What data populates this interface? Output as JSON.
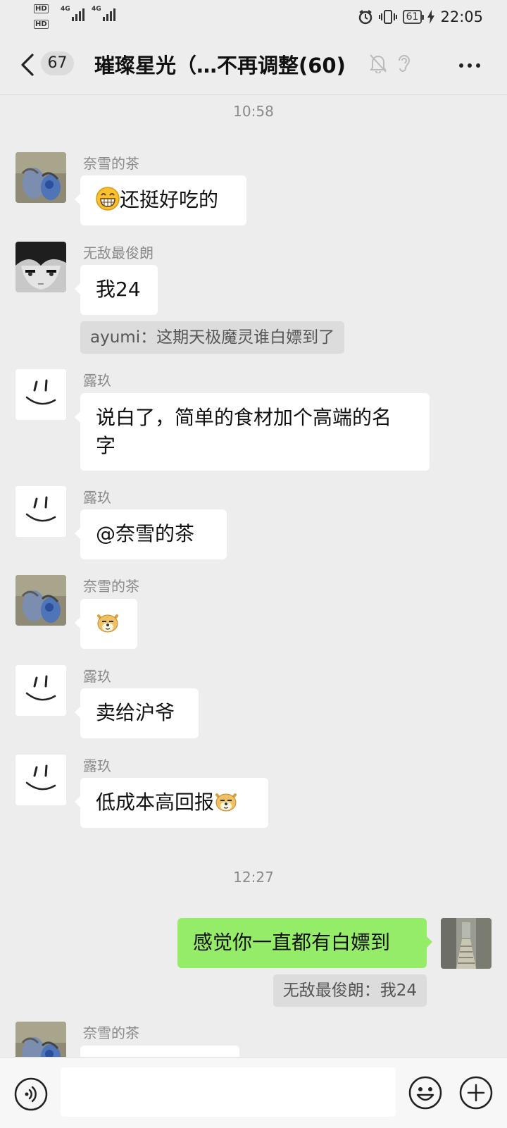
{
  "status_bar": {
    "hd_1": "HD",
    "hd_2": "HD",
    "net_1": "4G",
    "net_2": "4G",
    "battery": "61",
    "time": "22:05",
    "icons": [
      "alarm-icon",
      "vibrate-icon",
      "battery-icon",
      "charging-icon",
      "signal-icon"
    ]
  },
  "header": {
    "unread_count": "67",
    "title": "璀璨星光（…不再调整(60)",
    "icons": [
      "back-chevron-icon",
      "mute-bell-icon",
      "earpiece-icon",
      "more-icon"
    ]
  },
  "timestamps": [
    "10:58",
    "12:27"
  ],
  "messages": [
    {
      "sender": "奈雪的茶",
      "text": "还挺好吃的",
      "emoji": "grin-emoji"
    },
    {
      "sender": "无敌最俊朗",
      "text": "我24",
      "quote": "ayumi：这期天极魔灵谁白嫖到了"
    },
    {
      "sender": "露玖",
      "text_line1": "说白了，简单的食材加个高端的名",
      "text_line2": "字"
    },
    {
      "sender": "露玖",
      "text": "@奈雪的茶"
    },
    {
      "sender": "奈雪的茶",
      "emoji": "doge-emoji"
    },
    {
      "sender": "露玖",
      "text": "卖给沪爷"
    },
    {
      "sender": "露玖",
      "text": "低成本高回报",
      "emoji": "doge-emoji"
    },
    {
      "sender": "me",
      "text": "感觉你一直都有白嫖到",
      "quote": "无敌最俊朗：我24"
    },
    {
      "sender": "奈雪的茶"
    }
  ],
  "input_bar": {
    "icons": [
      "voice-icon",
      "emoji-icon",
      "plus-icon"
    ]
  },
  "colors": {
    "background": "#ededed",
    "bubble_mine": "#95ec69",
    "bubble_other": "#ffffff",
    "muted_text": "#8a8a8a"
  }
}
